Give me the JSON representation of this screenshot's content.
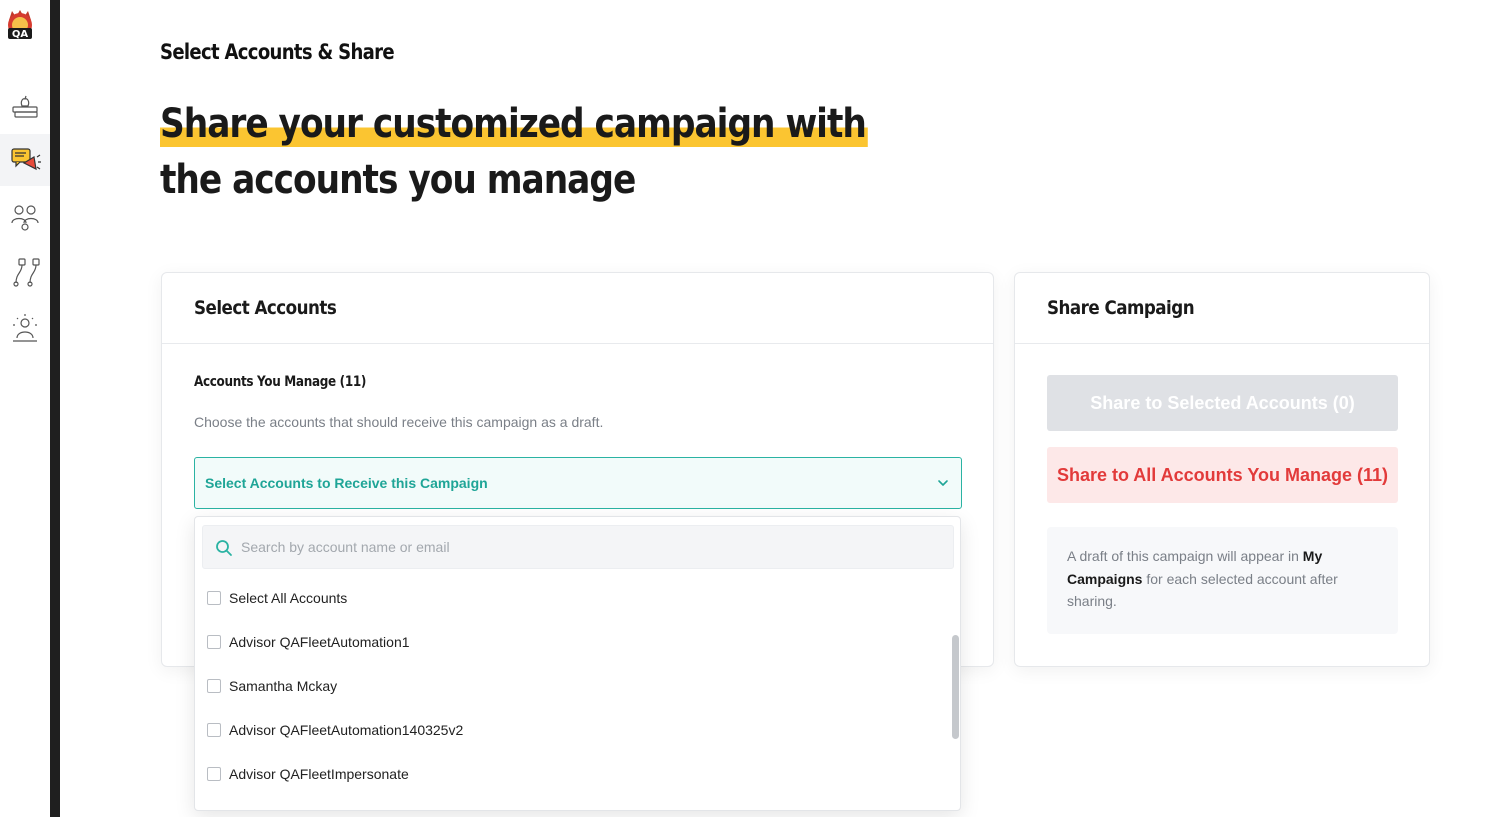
{
  "sidebar": {
    "logo": "QA",
    "items": [
      {
        "name": "library-icon",
        "active": false
      },
      {
        "name": "campaign-megaphone-icon",
        "active": true
      },
      {
        "name": "people-icon",
        "active": false
      },
      {
        "name": "workflow-icon",
        "active": false
      },
      {
        "name": "community-icon",
        "active": false
      }
    ]
  },
  "page": {
    "eyebrow": "Select Accounts & Share",
    "hero_line1": "Share your customized campaign with",
    "hero_line2": "the accounts you manage"
  },
  "select_card": {
    "title": "Select Accounts",
    "subtitle": "Accounts You Manage (11)",
    "description": "Choose the accounts that should receive this campaign as a draft.",
    "select_label": "Select Accounts to Receive this Campaign"
  },
  "dropdown": {
    "search_placeholder": "Search by account name or email",
    "options": [
      "Select All Accounts",
      "Advisor QAFleetAutomation1",
      "Samantha Mckay",
      "Advisor QAFleetAutomation140325v2",
      "Advisor QAFleetImpersonate"
    ]
  },
  "share_card": {
    "title": "Share Campaign",
    "share_selected": "Share to Selected Accounts (0)",
    "share_all": "Share to All Accounts You Manage (11)",
    "note_pre": "A draft of this campaign will appear in ",
    "note_bold": "My Campaigns",
    "note_post": " for each selected account after sharing."
  },
  "colors": {
    "accent_teal": "#1fa597",
    "highlight_yellow": "#fbc531",
    "danger_red": "#e23a3a",
    "disabled_gray": "#dfe1e5"
  }
}
